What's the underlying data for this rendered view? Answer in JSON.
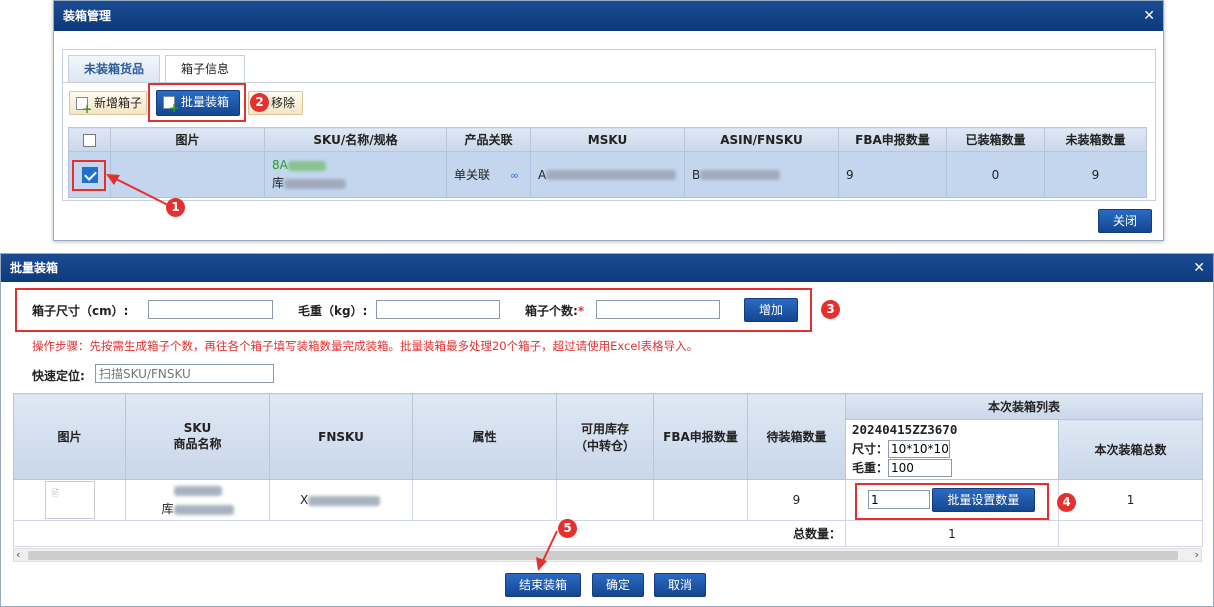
{
  "dialog1": {
    "title": "装箱管理",
    "close_glyph": "✕",
    "tabs": [
      "未装箱货品",
      "箱子信息"
    ],
    "toolbar": {
      "add_box": "新增箱子",
      "batch_pack": "批量装箱",
      "remove": "移除"
    },
    "columns": [
      "图片",
      "SKU/名称/规格",
      "产品关联",
      "MSKU",
      "ASIN/FNSKU",
      "FBA申报数量",
      "已装箱数量",
      "未装箱数量"
    ],
    "row": {
      "sku_prefix": "8A",
      "name_prefix": "库",
      "link": "单关联",
      "msku_prefix": "A",
      "asin_prefix": "B",
      "fba_qty": "9",
      "packed_qty": "0",
      "unpacked_qty": "9",
      "checked": true
    },
    "close_button": "关闭"
  },
  "dialog2": {
    "title": "批量装箱",
    "close_glyph": "✕",
    "size_label": "箱子尺寸（cm）:",
    "weight_label": "毛重（kg）:",
    "count_label": "箱子个数:",
    "required_mark": "*",
    "add_button": "增加",
    "hint": "操作步骤：先按需生成箱子个数，再往各个箱子填写装箱数量完成装箱。批量装箱最多处理20个箱子，超过请使用Excel表格导入。",
    "quick_label": "快速定位:",
    "quick_placeholder": "扫描SKU/FNSKU",
    "columns": {
      "image": "图片",
      "sku": "SKU",
      "product_name": "商品名称",
      "fnsku": "FNSKU",
      "attr": "属性",
      "stock": "可用库存",
      "stock_sub": "（中转仓）",
      "fba_qty": "FBA申报数量",
      "pending": "待装箱数量",
      "list_group": "本次装箱列表",
      "total_col": "本次装箱总数"
    },
    "box": {
      "id": "20240415ZZ3670",
      "size_label": "尺寸：",
      "size_value": "10*10*10",
      "weight_label": "毛重：",
      "weight_value": "100"
    },
    "row": {
      "name_prefix": "库",
      "fnsku_prefix": "X",
      "pending": "9",
      "qty": "1",
      "batch_set": "批量设置数量",
      "total": "1"
    },
    "total_label": "总数量：",
    "total_value": "1",
    "buttons": {
      "finish": "结束装箱",
      "confirm": "确定",
      "cancel": "取消"
    }
  },
  "badges": [
    "1",
    "2",
    "3",
    "4",
    "5"
  ],
  "colors": {
    "accent": "#15468f",
    "annotation": "#e53030"
  }
}
